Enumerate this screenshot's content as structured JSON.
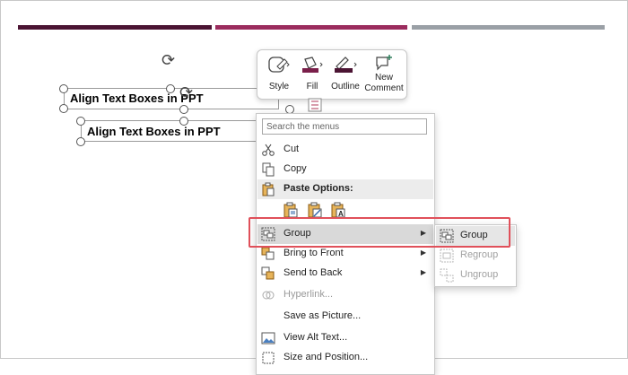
{
  "slide": {
    "textbox_front": "Align Text Boxes in PPT",
    "textbox_back": "Align Text Boxes in PPT"
  },
  "mini_toolbar": {
    "style": "Style",
    "fill": "Fill",
    "outline": "Outline",
    "new_comment_1": "New",
    "new_comment_2": "Comment",
    "fill_color": "#7a1f4a",
    "outline_color": "#4b1433"
  },
  "menu": {
    "search_placeholder": "Search the menus",
    "items": [
      {
        "label": "Cut",
        "icon": "scissors-icon"
      },
      {
        "label": "Copy",
        "icon": "copy-icon"
      },
      {
        "label": "Paste Options:",
        "icon": "paste-icon"
      },
      {
        "label": "Group",
        "icon": "group-icon"
      },
      {
        "label": "Bring to Front",
        "icon": "bring-front-icon"
      },
      {
        "label": "Send to Back",
        "icon": "send-back-icon"
      },
      {
        "label": "Hyperlink...",
        "icon": "hyperlink-icon"
      },
      {
        "label": "Save as Picture...",
        "icon": ""
      },
      {
        "label": "View Alt Text...",
        "icon": "alt-text-icon"
      },
      {
        "label": "Size and Position...",
        "icon": "size-position-icon"
      }
    ]
  },
  "submenu": {
    "items": [
      {
        "label": "Group"
      },
      {
        "label": "Regroup"
      },
      {
        "label": "Ungroup"
      }
    ]
  },
  "colors": {
    "highlight_box": "#e0505a",
    "accent_bar_1": "#4b1433",
    "accent_bar_2": "#9b2c5e",
    "accent_bar_3": "#9aa0a6"
  }
}
